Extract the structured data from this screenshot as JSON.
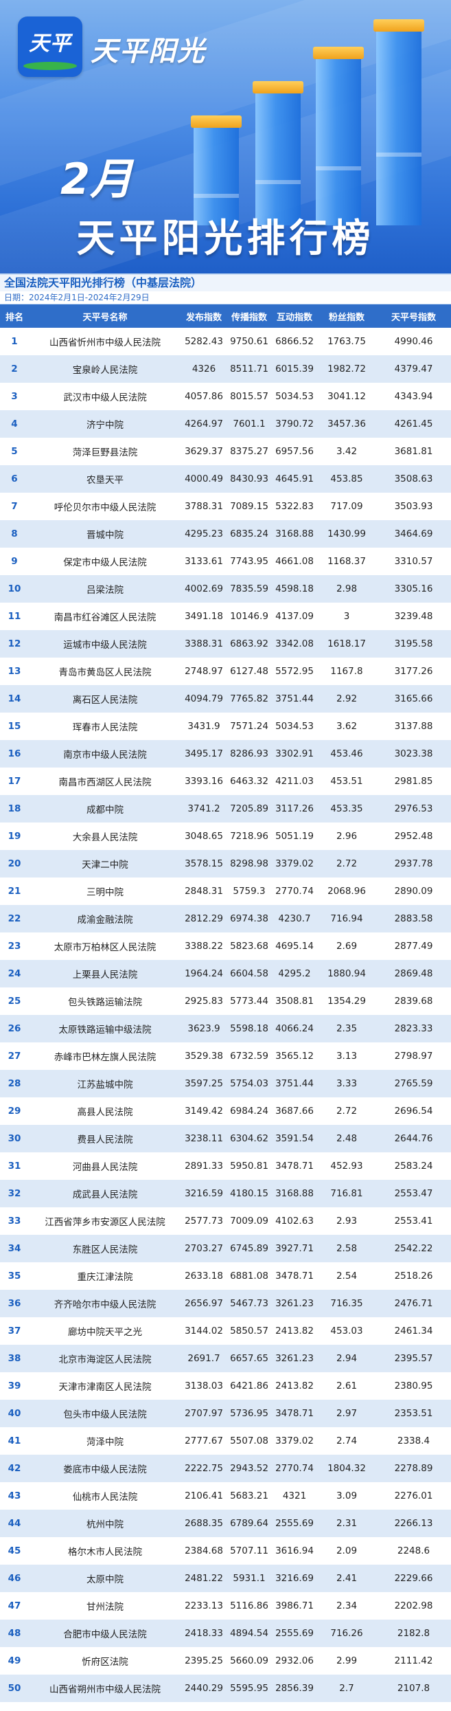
{
  "banner": {
    "logo_text": "天平",
    "brand_name": "天平阳光",
    "month": "2月",
    "title": "天平阳光排行榜"
  },
  "subtitle": "全国法院天平阳光排行榜（中基层法院）",
  "date_range": "日期：2024年2月1日-2024年2月29日",
  "colors": {
    "header_bg": "#2f6ec9",
    "stripe": "#dde9f7",
    "rank_text": "#1a5fc0",
    "banner_blue": "#2f72d8",
    "bar_cap": "#f0a21c"
  },
  "table": {
    "headers": [
      "排名",
      "天平号名称",
      "发布指数",
      "传播指数",
      "互动指数",
      "粉丝指数",
      "天平号指数"
    ],
    "rows": [
      [
        "1",
        "山西省忻州市中级人民法院",
        "5282.43",
        "9750.61",
        "6866.52",
        "1763.75",
        "4990.46"
      ],
      [
        "2",
        "宝泉岭人民法院",
        "4326",
        "8511.71",
        "6015.39",
        "1982.72",
        "4379.47"
      ],
      [
        "3",
        "武汉市中级人民法院",
        "4057.86",
        "8015.57",
        "5034.53",
        "3041.12",
        "4343.94"
      ],
      [
        "4",
        "济宁中院",
        "4264.97",
        "7601.1",
        "3790.72",
        "3457.36",
        "4261.45"
      ],
      [
        "5",
        "菏泽巨野县法院",
        "3629.37",
        "8375.27",
        "6957.56",
        "3.42",
        "3681.81"
      ],
      [
        "6",
        "农垦天平",
        "4000.49",
        "8430.93",
        "4645.91",
        "453.85",
        "3508.63"
      ],
      [
        "7",
        "呼伦贝尔市中级人民法院",
        "3788.31",
        "7089.15",
        "5322.83",
        "717.09",
        "3503.93"
      ],
      [
        "8",
        "晋城中院",
        "4295.23",
        "6835.24",
        "3168.88",
        "1430.99",
        "3464.69"
      ],
      [
        "9",
        "保定市中级人民法院",
        "3133.61",
        "7743.95",
        "4661.08",
        "1168.37",
        "3310.57"
      ],
      [
        "10",
        "吕梁法院",
        "4002.69",
        "7835.59",
        "4598.18",
        "2.98",
        "3305.16"
      ],
      [
        "11",
        "南昌市红谷滩区人民法院",
        "3491.18",
        "10146.9",
        "4137.09",
        "3",
        "3239.48"
      ],
      [
        "12",
        "运城市中级人民法院",
        "3388.31",
        "6863.92",
        "3342.08",
        "1618.17",
        "3195.58"
      ],
      [
        "13",
        "青岛市黄岛区人民法院",
        "2748.97",
        "6127.48",
        "5572.95",
        "1167.8",
        "3177.26"
      ],
      [
        "14",
        "离石区人民法院",
        "4094.79",
        "7765.82",
        "3751.44",
        "2.92",
        "3165.66"
      ],
      [
        "15",
        "珲春市人民法院",
        "3431.9",
        "7571.24",
        "5034.53",
        "3.62",
        "3137.88"
      ],
      [
        "16",
        "南京市中级人民法院",
        "3495.17",
        "8286.93",
        "3302.91",
        "453.46",
        "3023.38"
      ],
      [
        "17",
        "南昌市西湖区人民法院",
        "3393.16",
        "6463.32",
        "4211.03",
        "453.51",
        "2981.85"
      ],
      [
        "18",
        "成都中院",
        "3741.2",
        "7205.89",
        "3117.26",
        "453.35",
        "2976.53"
      ],
      [
        "19",
        "大余县人民法院",
        "3048.65",
        "7218.96",
        "5051.19",
        "2.96",
        "2952.48"
      ],
      [
        "20",
        "天津二中院",
        "3578.15",
        "8298.98",
        "3379.02",
        "2.72",
        "2937.78"
      ],
      [
        "21",
        "三明中院",
        "2848.31",
        "5759.3",
        "2770.74",
        "2068.96",
        "2890.09"
      ],
      [
        "22",
        "成渝金融法院",
        "2812.29",
        "6974.38",
        "4230.7",
        "716.94",
        "2883.58"
      ],
      [
        "23",
        "太原市万柏林区人民法院",
        "3388.22",
        "5823.68",
        "4695.14",
        "2.69",
        "2877.49"
      ],
      [
        "24",
        "上栗县人民法院",
        "1964.24",
        "6604.58",
        "4295.2",
        "1880.94",
        "2869.48"
      ],
      [
        "25",
        "包头铁路运输法院",
        "2925.83",
        "5773.44",
        "3508.81",
        "1354.29",
        "2839.68"
      ],
      [
        "26",
        "太原铁路运输中级法院",
        "3623.9",
        "5598.18",
        "4066.24",
        "2.35",
        "2823.33"
      ],
      [
        "27",
        "赤峰市巴林左旗人民法院",
        "3529.38",
        "6732.59",
        "3565.12",
        "3.13",
        "2798.97"
      ],
      [
        "28",
        "江苏盐城中院",
        "3597.25",
        "5754.03",
        "3751.44",
        "3.33",
        "2765.59"
      ],
      [
        "29",
        "高县人民法院",
        "3149.42",
        "6984.24",
        "3687.66",
        "2.72",
        "2696.54"
      ],
      [
        "30",
        "费县人民法院",
        "3238.11",
        "6304.62",
        "3591.54",
        "2.48",
        "2644.76"
      ],
      [
        "31",
        "河曲县人民法院",
        "2891.33",
        "5950.81",
        "3478.71",
        "452.93",
        "2583.24"
      ],
      [
        "32",
        "成武县人民法院",
        "3216.59",
        "4180.15",
        "3168.88",
        "716.81",
        "2553.47"
      ],
      [
        "33",
        "江西省萍乡市安源区人民法院",
        "2577.73",
        "7009.09",
        "4102.63",
        "2.93",
        "2553.41"
      ],
      [
        "34",
        "东胜区人民法院",
        "2703.27",
        "6745.89",
        "3927.71",
        "2.58",
        "2542.22"
      ],
      [
        "35",
        "重庆江津法院",
        "2633.18",
        "6881.08",
        "3478.71",
        "2.54",
        "2518.26"
      ],
      [
        "36",
        "齐齐哈尔市中级人民法院",
        "2656.97",
        "5467.73",
        "3261.23",
        "716.35",
        "2476.71"
      ],
      [
        "37",
        "廊坊中院天平之光",
        "3144.02",
        "5850.57",
        "2413.82",
        "453.03",
        "2461.34"
      ],
      [
        "38",
        "北京市海淀区人民法院",
        "2691.7",
        "6657.65",
        "3261.23",
        "2.94",
        "2395.57"
      ],
      [
        "39",
        "天津市津南区人民法院",
        "3138.03",
        "6421.86",
        "2413.82",
        "2.61",
        "2380.95"
      ],
      [
        "40",
        "包头市中级人民法院",
        "2707.97",
        "5736.95",
        "3478.71",
        "2.97",
        "2353.51"
      ],
      [
        "41",
        "菏泽中院",
        "2777.67",
        "5507.08",
        "3379.02",
        "2.74",
        "2338.4"
      ],
      [
        "42",
        "娄底市中级人民法院",
        "2222.75",
        "2943.52",
        "2770.74",
        "1804.32",
        "2278.89"
      ],
      [
        "43",
        "仙桃市人民法院",
        "2106.41",
        "5683.21",
        "4321",
        "3.09",
        "2276.01"
      ],
      [
        "44",
        "杭州中院",
        "2688.35",
        "6789.64",
        "2555.69",
        "2.31",
        "2266.13"
      ],
      [
        "45",
        "格尔木市人民法院",
        "2384.68",
        "5707.11",
        "3616.94",
        "2.09",
        "2248.6"
      ],
      [
        "46",
        "太原中院",
        "2481.22",
        "5931.1",
        "3216.69",
        "2.41",
        "2229.66"
      ],
      [
        "47",
        "甘州法院",
        "2233.13",
        "5116.86",
        "3986.71",
        "2.34",
        "2202.98"
      ],
      [
        "48",
        "合肥市中级人民法院",
        "2418.33",
        "4894.54",
        "2555.69",
        "716.26",
        "2182.8"
      ],
      [
        "49",
        "忻府区法院",
        "2395.25",
        "5660.09",
        "2932.06",
        "2.99",
        "2111.42"
      ],
      [
        "50",
        "山西省朔州市中级人民法院",
        "2440.29",
        "5595.95",
        "2856.39",
        "2.7",
        "2107.8"
      ]
    ]
  }
}
